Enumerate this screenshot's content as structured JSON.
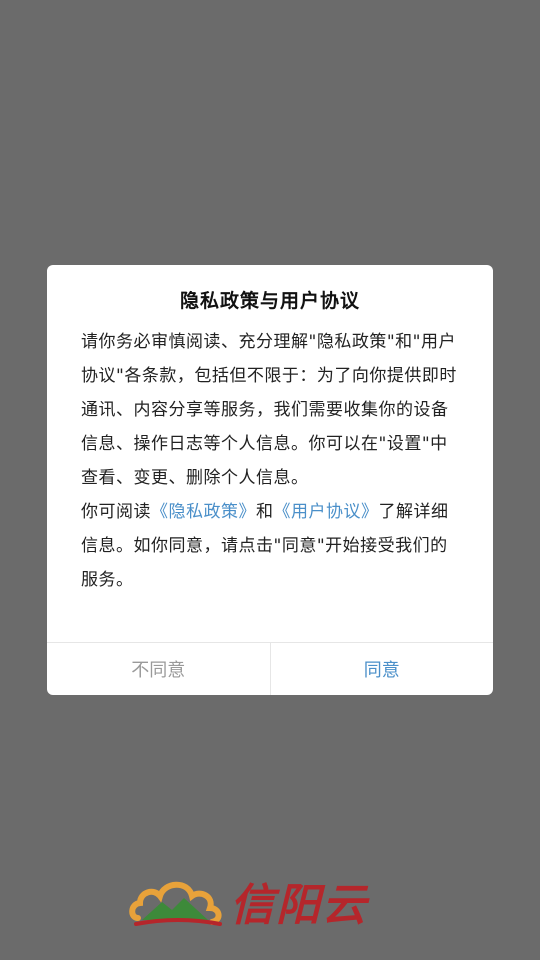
{
  "dialog": {
    "title": "隐私政策与用户协议",
    "paragraph1": "请你务必审慎阅读、充分理解\"隐私政策\"和\"用户协议\"各条款，包括但不限于：为了向你提供即时通讯、内容分享等服务，我们需要收集你的设备信息、操作日志等个人信息。你可以在\"设置\"中查看、变更、删除个人信息。",
    "paragraph2_prefix": "你可阅读",
    "privacy_link": "《隐私政策》",
    "paragraph2_and": "和",
    "agreement_link": "《用户协议》",
    "paragraph2_suffix": "了解详细信息。如你同意，请点击\"同意\"开始接受我们的服务。",
    "disagree_label": "不同意",
    "agree_label": "同意"
  },
  "logo": {
    "text": "信阳云"
  },
  "colors": {
    "overlay": "#6b6b6b",
    "link": "#4a8fc9",
    "brand_red": "#b5262b",
    "logo_green": "#3d8a3a",
    "logo_orange": "#e8a23a"
  }
}
